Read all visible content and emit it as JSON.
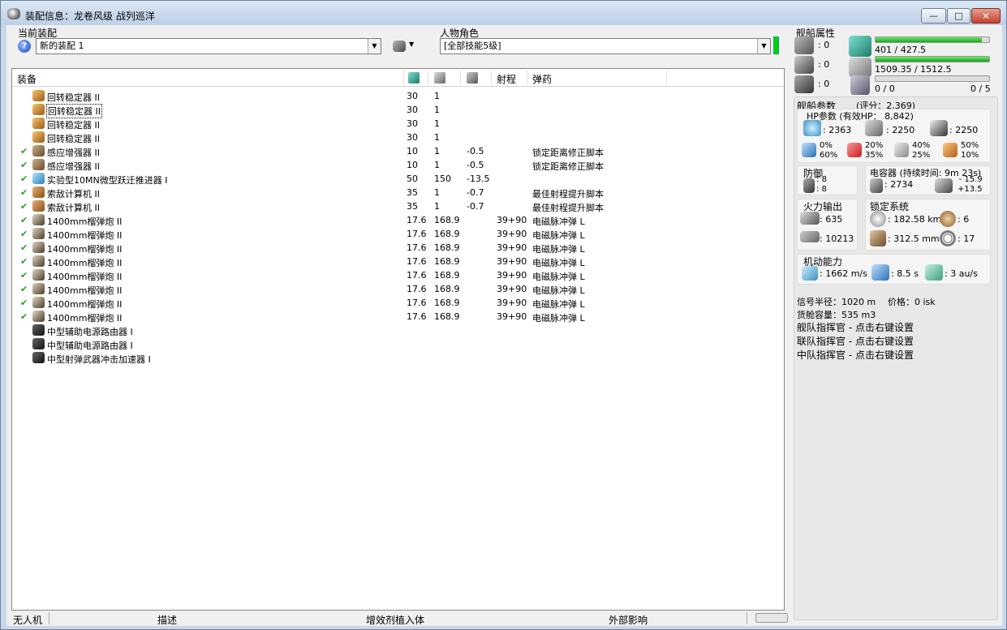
{
  "window": {
    "title": "装配信息：龙卷风级 战列巡洋",
    "minimize": "—",
    "maximize": "□",
    "close": "×"
  },
  "current_fit": {
    "label": "当前装配",
    "help": "?",
    "value": "新的装配  1",
    "dropdown_icon": "chevron-down-icon"
  },
  "character": {
    "label": "人物角色",
    "value": "[全部技能5级]"
  },
  "list": {
    "headers": {
      "equipment": "装备",
      "range": "射程",
      "ammo": "弹药"
    },
    "rows": [
      {
        "checked": false,
        "icon": "ic-stab",
        "name": "回转稳定器 II",
        "cpu": "30",
        "pg": "1",
        "cap": "",
        "range": "",
        "ammo": "",
        "selected": false
      },
      {
        "checked": false,
        "icon": "ic-stab",
        "name": "回转稳定器 II",
        "cpu": "30",
        "pg": "1",
        "cap": "",
        "range": "",
        "ammo": "",
        "selected": true
      },
      {
        "checked": false,
        "icon": "ic-stab",
        "name": "回转稳定器 II",
        "cpu": "30",
        "pg": "1",
        "cap": "",
        "range": "",
        "ammo": "",
        "selected": false
      },
      {
        "checked": false,
        "icon": "ic-stab",
        "name": "回转稳定器 II",
        "cpu": "30",
        "pg": "1",
        "cap": "",
        "range": "",
        "ammo": "",
        "selected": false
      },
      {
        "checked": true,
        "icon": "ic-sens",
        "name": "感应增强器 II",
        "cpu": "10",
        "pg": "1",
        "cap": "-0.5",
        "range": "",
        "ammo": "锁定距离修正脚本",
        "selected": false
      },
      {
        "checked": true,
        "icon": "ic-sens",
        "name": "感应增强器 II",
        "cpu": "10",
        "pg": "1",
        "cap": "-0.5",
        "range": "",
        "ammo": "锁定距离修正脚本",
        "selected": false
      },
      {
        "checked": true,
        "icon": "ic-mwd",
        "name": "实验型10MN微型跃迁推进器 I",
        "cpu": "50",
        "pg": "150",
        "cap": "-13.5",
        "range": "",
        "ammo": "",
        "selected": false
      },
      {
        "checked": true,
        "icon": "ic-comp",
        "name": "索敌计算机 II",
        "cpu": "35",
        "pg": "1",
        "cap": "-0.7",
        "range": "",
        "ammo": "最佳射程提升脚本",
        "selected": false
      },
      {
        "checked": true,
        "icon": "ic-comp",
        "name": "索敌计算机 II",
        "cpu": "35",
        "pg": "1",
        "cap": "-0.7",
        "range": "",
        "ammo": "最佳射程提升脚本",
        "selected": false
      },
      {
        "checked": true,
        "icon": "ic-gun",
        "name": "1400mm榴弹炮 II",
        "cpu": "17.6",
        "pg": "168.9",
        "cap": "",
        "range": "39+90",
        "ammo": "电磁脉冲弹 L",
        "selected": false
      },
      {
        "checked": true,
        "icon": "ic-gun",
        "name": "1400mm榴弹炮 II",
        "cpu": "17.6",
        "pg": "168.9",
        "cap": "",
        "range": "39+90",
        "ammo": "电磁脉冲弹 L",
        "selected": false
      },
      {
        "checked": true,
        "icon": "ic-gun",
        "name": "1400mm榴弹炮 II",
        "cpu": "17.6",
        "pg": "168.9",
        "cap": "",
        "range": "39+90",
        "ammo": "电磁脉冲弹 L",
        "selected": false
      },
      {
        "checked": true,
        "icon": "ic-gun",
        "name": "1400mm榴弹炮 II",
        "cpu": "17.6",
        "pg": "168.9",
        "cap": "",
        "range": "39+90",
        "ammo": "电磁脉冲弹 L",
        "selected": false
      },
      {
        "checked": true,
        "icon": "ic-gun",
        "name": "1400mm榴弹炮 II",
        "cpu": "17.6",
        "pg": "168.9",
        "cap": "",
        "range": "39+90",
        "ammo": "电磁脉冲弹 L",
        "selected": false
      },
      {
        "checked": true,
        "icon": "ic-gun",
        "name": "1400mm榴弹炮 II",
        "cpu": "17.6",
        "pg": "168.9",
        "cap": "",
        "range": "39+90",
        "ammo": "电磁脉冲弹 L",
        "selected": false
      },
      {
        "checked": true,
        "icon": "ic-gun",
        "name": "1400mm榴弹炮 II",
        "cpu": "17.6",
        "pg": "168.9",
        "cap": "",
        "range": "39+90",
        "ammo": "电磁脉冲弹 L",
        "selected": false
      },
      {
        "checked": true,
        "icon": "ic-gun",
        "name": "1400mm榴弹炮 II",
        "cpu": "17.6",
        "pg": "168.9",
        "cap": "",
        "range": "39+90",
        "ammo": "电磁脉冲弹 L",
        "selected": false
      },
      {
        "checked": false,
        "icon": "ic-rig",
        "name": "中型辅助电源路由器 I",
        "cpu": "",
        "pg": "",
        "cap": "",
        "range": "",
        "ammo": "",
        "selected": false
      },
      {
        "checked": false,
        "icon": "ic-rig",
        "name": "中型辅助电源路由器 I",
        "cpu": "",
        "pg": "",
        "cap": "",
        "range": "",
        "ammo": "",
        "selected": false
      },
      {
        "checked": false,
        "icon": "ic-rig",
        "name": "中型射弹武器冲击加速器 I",
        "cpu": "",
        "pg": "",
        "cap": "",
        "range": "",
        "ammo": "",
        "selected": false
      }
    ]
  },
  "statusbar": {
    "drones": "无人机",
    "description": "描述",
    "boosters": "增效剂植入体",
    "external": "外部影响"
  },
  "ship": {
    "label": "舰船属性",
    "hardpoints": [
      "0",
      "0",
      "0"
    ],
    "cpu": {
      "text": "401 / 427.5",
      "ratio": 0.938
    },
    "power": {
      "text": "1509.35 / 1512.5",
      "ratio": 0.998
    },
    "calib_left": "0 / 0",
    "calib_right": "0 / 5"
  },
  "stats": {
    "label": "舰船参数",
    "rating": "(评分：2,369)",
    "hp_label": "HP参数 (有效HP：  8,842)",
    "hp": [
      "2363",
      "2250",
      "2250"
    ],
    "resists": [
      [
        "0%",
        "60%"
      ],
      [
        "20%",
        "35%"
      ],
      [
        "40%",
        "25%"
      ],
      [
        "50%",
        "10%"
      ]
    ],
    "defense": {
      "label": "防御",
      "a": "8",
      "b": "8"
    },
    "capacitor": {
      "label": "电容器 (持续时间: 9m 23s)",
      "value": "2734",
      "minus": "- 15.9",
      "plus": "+13.5"
    },
    "firepower": {
      "label": "火力输出",
      "dps": "635",
      "volley": "10213"
    },
    "targeting": {
      "label": "锁定系统",
      "range": "182.58 km",
      "targets": "6",
      "scan": "312.5 mm",
      "sensor": "17"
    },
    "mobility": {
      "label": "机动能力",
      "speed": "1662 m/s",
      "align": "8.5 s",
      "warp": "3 au/s"
    },
    "signature": "信号半径：1020 m",
    "price": "价格：0 isk",
    "cargo": "货舱容量：535 m3",
    "fleet_cmd": "舰队指挥官 - 点击右键设置",
    "wing_cmd": "联队指挥官 - 点击右键设置",
    "squad_cmd": "中队指挥官 - 点击右键设置"
  }
}
